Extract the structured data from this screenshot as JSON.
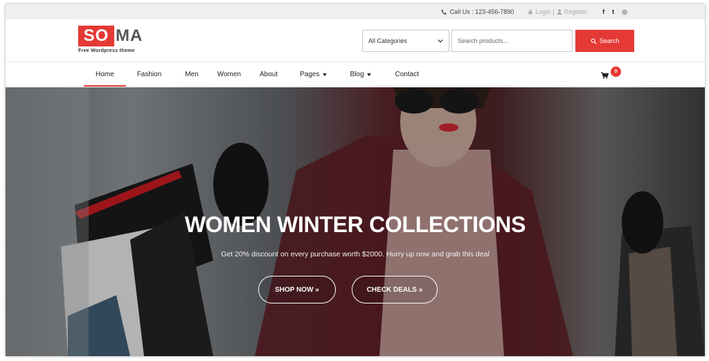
{
  "topbar": {
    "call_label": "Call Us : 123-456-7890",
    "login_label": "Login",
    "separator": "|",
    "register_label": "Register",
    "social": [
      "f",
      "t",
      "◎"
    ]
  },
  "brand": {
    "logo_part1": "SO",
    "logo_part2": "MA",
    "tagline": "Free Wordpress theme",
    "accent_color": "#e53935"
  },
  "search": {
    "category_value": "All Categories",
    "input_placeholder": "Search products...",
    "button_label": "Search"
  },
  "nav": {
    "items": [
      {
        "label": "Home",
        "active": true
      },
      {
        "label": "Fashion"
      },
      {
        "label": "Men"
      },
      {
        "label": "Women"
      },
      {
        "label": "About"
      },
      {
        "label": "Pages",
        "dropdown": true
      },
      {
        "label": "Blog",
        "dropdown": true
      },
      {
        "label": "Contact"
      }
    ],
    "cart_count": "0"
  },
  "hero": {
    "title": "WOMEN WINTER COLLECTIONS",
    "subtitle": "Get 20% discount on every purchase worth $2000. Hurry up now and grab this deal",
    "shop_button": "SHOP NOW »",
    "deals_button": "CHECK DEALS »"
  }
}
